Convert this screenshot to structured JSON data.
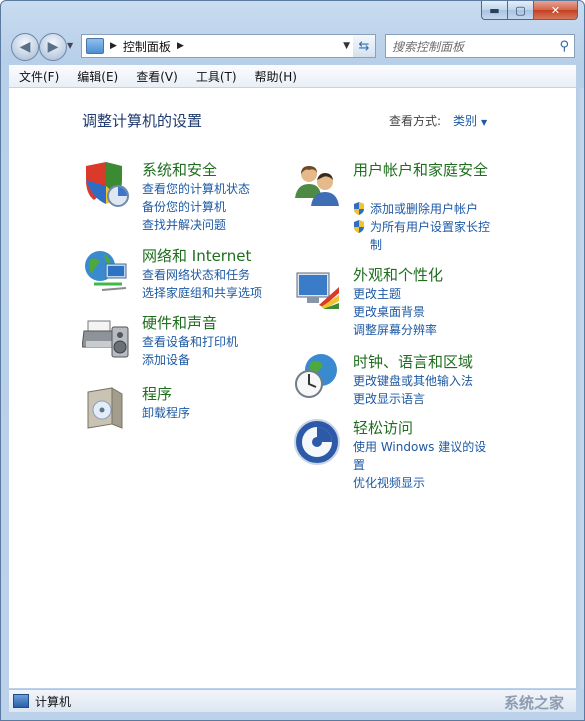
{
  "window": {
    "caption_buttons": {
      "minimize": "▬",
      "maximize": "▢",
      "close": "✕"
    }
  },
  "navbar": {
    "breadcrumb": "控制面板",
    "search_placeholder": "搜索控制面板",
    "icons": {
      "back": "left-arrow-icon",
      "forward": "right-arrow-icon",
      "refresh": "refresh-icon",
      "search": "magnifier-icon"
    }
  },
  "menu": [
    "文件(F)",
    "编辑(E)",
    "查看(V)",
    "工具(T)",
    "帮助(H)"
  ],
  "main": {
    "title": "调整计算机的设置",
    "view_by_label": "查看方式:",
    "view_by_value": "类别",
    "categories": [
      {
        "name": "系统和安全",
        "icon": "shield-system-icon",
        "links": [
          "查看您的计算机状态",
          "备份您的计算机",
          "查找并解决问题"
        ]
      },
      {
        "name": "网络和 Internet",
        "icon": "network-globe-icon",
        "links": [
          "查看网络状态和任务",
          "选择家庭组和共享选项"
        ]
      },
      {
        "name": "硬件和声音",
        "icon": "printer-speaker-icon",
        "links": [
          "查看设备和打印机",
          "添加设备"
        ]
      },
      {
        "name": "程序",
        "icon": "programs-box-icon",
        "links": [
          "卸载程序"
        ]
      },
      {
        "name": "用户帐户和家庭安全",
        "icon": "users-icon",
        "links": [
          "添加或删除用户帐户",
          "为所有用户设置家长控制"
        ]
      },
      {
        "name": "外观和个性化",
        "icon": "monitor-paint-icon",
        "links": [
          "更改主题",
          "更改桌面背景",
          "调整屏幕分辨率"
        ]
      },
      {
        "name": "时钟、语言和区域",
        "icon": "clock-globe-icon",
        "links": [
          "更改键盘或其他输入法",
          "更改显示语言"
        ]
      },
      {
        "name": "轻松访问",
        "icon": "ease-of-access-icon",
        "links": [
          "使用 Windows 建议的设置",
          "优化视频显示"
        ]
      }
    ]
  },
  "status": {
    "text": "计算机",
    "watermark": "系统之家"
  }
}
